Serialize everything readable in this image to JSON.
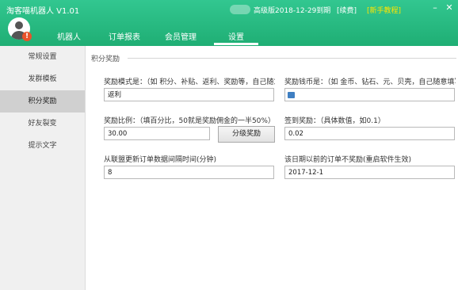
{
  "app": {
    "title": "淘客喵机器人 V1.01"
  },
  "header": {
    "version_text": "高级版2018-12-29到期",
    "renew_label": "[续费]",
    "guide_label": "[新手教程]",
    "minimize_glyph": "–",
    "close_glyph": "✕",
    "alert_glyph": "!"
  },
  "nav": {
    "tabs": [
      {
        "label": "机器人"
      },
      {
        "label": "订单报表"
      },
      {
        "label": "会员管理"
      },
      {
        "label": "设置"
      }
    ],
    "active": "设置"
  },
  "sidebar": {
    "items": [
      {
        "label": "常规设置"
      },
      {
        "label": "发群模板"
      },
      {
        "label": "积分奖励"
      },
      {
        "label": "好友裂变"
      },
      {
        "label": "提示文字"
      }
    ],
    "active": "积分奖励"
  },
  "section": {
    "title": "积分奖励"
  },
  "form": {
    "reward_mode_label": "奖励模式是：（如 积分、补贴、返利、奖励等，自己随意",
    "reward_mode_value": "返利",
    "currency_label": "奖励钱币是：（如 金币、钻石、元、贝壳，自己随意填写",
    "currency_value": "",
    "ratio_label": "奖励比例：（填百分比，50就是奖励佣金的一半50%）",
    "ratio_value": "30.00",
    "tier_button_label": "分级奖励",
    "checkin_label": "签到奖励：（具体数值，如0.1）",
    "checkin_value": "0.02",
    "refresh_label": "从联盟更新订单数据间隔时间(分钟)",
    "refresh_value": "8",
    "cutoff_label": "该日期以前的订单不奖励(重启软件生效)",
    "cutoff_value": "2017-12-1"
  }
}
